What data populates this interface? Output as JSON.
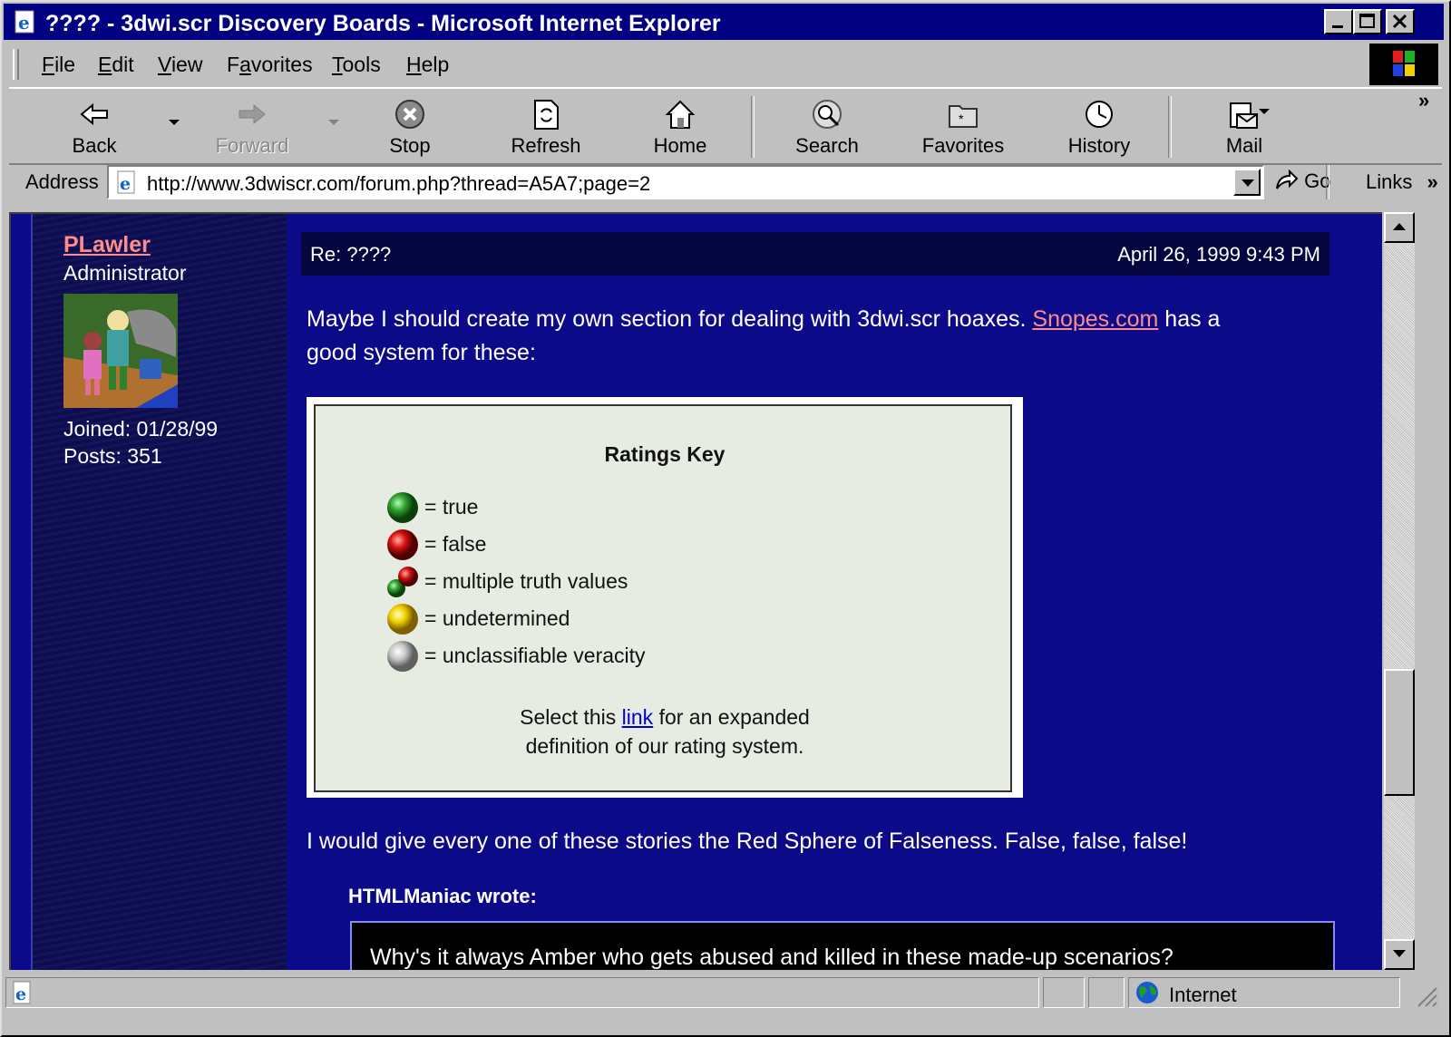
{
  "window": {
    "title": "???? - 3dwi.scr Discovery Boards - Microsoft Internet Explorer",
    "controls": [
      "minimize",
      "maximize",
      "close"
    ]
  },
  "menu": {
    "items": [
      {
        "label": "File",
        "key": "F"
      },
      {
        "label": "Edit",
        "key": "E"
      },
      {
        "label": "View",
        "key": "V"
      },
      {
        "label": "Favorites",
        "key": "a"
      },
      {
        "label": "Tools",
        "key": "T"
      },
      {
        "label": "Help",
        "key": "H"
      }
    ]
  },
  "toolbar": {
    "back": "Back",
    "forward": "Forward",
    "stop": "Stop",
    "refresh": "Refresh",
    "home": "Home",
    "search": "Search",
    "favorites": "Favorites",
    "history": "History",
    "mail": "Mail",
    "overflow": "»"
  },
  "address": {
    "label": "Address",
    "url": "http://www.3dwiscr.com/forum.php?thread=A5A7;page=2",
    "go": "Go",
    "links": "Links",
    "links_overflow": "»"
  },
  "post": {
    "author": {
      "name": "PLawler",
      "role": "Administrator",
      "joined": "Joined: 01/28/99",
      "posts": "Posts: 351"
    },
    "subject": "Re: ????",
    "date": "April 26, 1999 9:43 PM",
    "intro_before": "Maybe I should create my own section for dealing with 3dwi.scr hoaxes. ",
    "intro_link": "Snopes.com",
    "intro_after_1": " has a",
    "intro_after_2": "good system for these:",
    "ratings_key": {
      "title": "Ratings Key",
      "items": [
        {
          "label": "= true",
          "color": "#2fa02f"
        },
        {
          "label": "= false",
          "color": "#d81010"
        },
        {
          "label": "= multiple truth values",
          "color": "#d81010"
        },
        {
          "label": "= undetermined",
          "color": "#f0d000"
        },
        {
          "label": "= unclassifiable veracity",
          "color": "#c8c8c8"
        }
      ],
      "footer_before": "Select this ",
      "footer_link": "link",
      "footer_after": " for an expanded",
      "footer_line2": "definition of our rating system."
    },
    "closing": "I would give every one of these stories the Red Sphere of Falseness. False, false, false!",
    "quote_author": "HTMLManiac wrote:",
    "quote_text": "Why's it always Amber who gets abused and killed in these made-up scenarios?"
  },
  "status": {
    "zone": "Internet"
  }
}
